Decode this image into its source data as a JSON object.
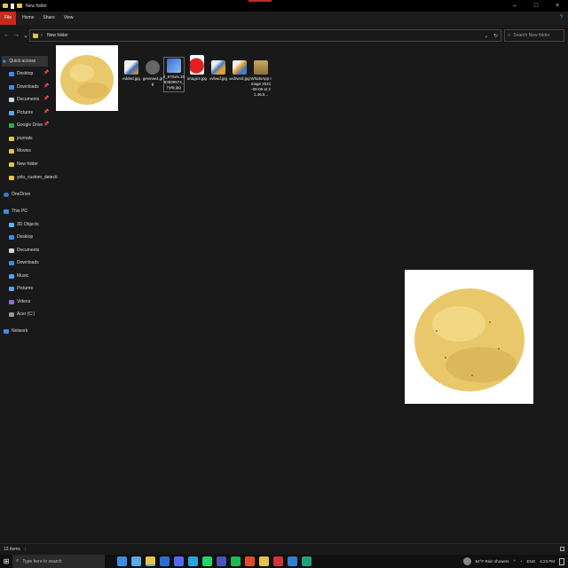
{
  "titlebar": {
    "title": "New folder",
    "controls": [
      "–",
      "□",
      "×"
    ]
  },
  "ribbon": {
    "tabs": [
      "File",
      "Home",
      "Share",
      "View"
    ],
    "help": "?"
  },
  "address": {
    "back": "←",
    "forward": "→",
    "recent": "⌄",
    "up": "↑",
    "crumb_sep": "›",
    "crumb": "New folder",
    "dropdown": "⌄",
    "refresh": "↻",
    "search_placeholder": "Search New folder"
  },
  "nav": {
    "quick_access": "Quick access",
    "quick_items": [
      "Desktop",
      "Downloads",
      "Documents",
      "Pictures",
      "Google Drive",
      "journals",
      "Movies",
      "New folder",
      "yolo_custom_detecti"
    ],
    "onedrive": "OneDrive",
    "this_pc": "This PC",
    "pc_items": [
      "3D Objects",
      "Desktop",
      "Documents",
      "Downloads",
      "Music",
      "Pictures",
      "Videos",
      "Acer (C:)"
    ],
    "network": "Network",
    "pin": "📌"
  },
  "files": [
    {
      "name": ""
    },
    {
      "name": "edded.jpg"
    },
    {
      "name": "gevvvw4.jpg"
    },
    {
      "name": "il_570xN.1963699574_hy9j.jpg"
    },
    {
      "name": "image2.jpg"
    },
    {
      "name": "vvbwd.jpg"
    },
    {
      "name": "wcbwvd.jpg"
    },
    {
      "name": "WhatsApp Image 2021-08-09 at 21.46.5..."
    }
  ],
  "status": {
    "count": "13 items",
    "sep": "|"
  },
  "taskbar": {
    "search_placeholder": "Type here to search",
    "weather": "84°F  Rain showers",
    "lang": "ENG",
    "time": "4:23 PM"
  },
  "colors": {
    "accent": "#c42b1c",
    "folder": "#e8c34a",
    "potato": "#e8c86a"
  }
}
